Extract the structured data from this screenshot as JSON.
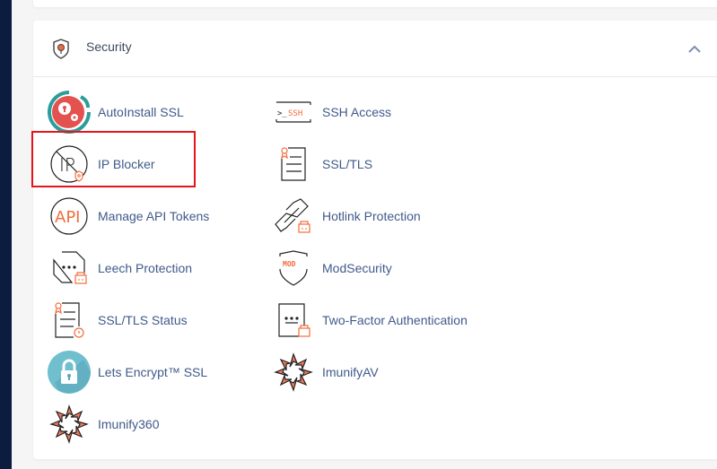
{
  "section": {
    "title": "Security",
    "icon": "shield-keyhole-icon",
    "collapse_icon": "chevron-up-icon"
  },
  "colors": {
    "sidebar": "#0b1c3f",
    "link": "#3f5a8a",
    "accent_orange": "#f26d3d",
    "highlight_border": "#e5141a"
  },
  "items": [
    {
      "label": "AutoInstall SSL",
      "icon": "autoinstall-ssl-icon"
    },
    {
      "label": "SSH Access",
      "icon": "ssh-terminal-icon",
      "icon_text": ">_SSH"
    },
    {
      "label": "IP Blocker",
      "icon": "ip-blocker-icon",
      "icon_text": "IP",
      "highlighted": true
    },
    {
      "label": "SSL/TLS",
      "icon": "certificate-icon"
    },
    {
      "label": "Manage API Tokens",
      "icon": "api-icon",
      "icon_text": "API"
    },
    {
      "label": "Hotlink Protection",
      "icon": "hotlink-chain-icon"
    },
    {
      "label": "Leech Protection",
      "icon": "leech-protection-icon"
    },
    {
      "label": "ModSecurity",
      "icon": "modsecurity-shield-icon",
      "icon_text": "MOD"
    },
    {
      "label": "SSL/TLS Status",
      "icon": "ssl-status-icon"
    },
    {
      "label": "Two-Factor Authentication",
      "icon": "two-factor-icon"
    },
    {
      "label": "Lets Encrypt™ SSL",
      "icon": "lets-encrypt-lock-icon"
    },
    {
      "label": "ImunifyAV",
      "icon": "imunify-icon"
    },
    {
      "label": "Imunify360",
      "icon": "imunify-icon"
    }
  ]
}
